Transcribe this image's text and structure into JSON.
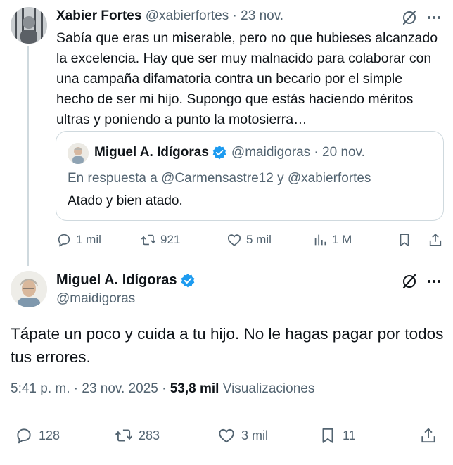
{
  "parent_tweet": {
    "author_name": "Xabier Fortes",
    "handle_date": "@xabierfortes · 23 nov.",
    "text": "Sabía que eras un miserable, pero no que hubieses alcanzado la excelencia. Hay que ser muy malnacido para colaborar con una campaña difamatoria contra un becario por el simple hecho de ser mi hijo. Supongo que estás haciendo méritos ultras y poniendo a punto la motosierra…",
    "quote": {
      "author_name": "Miguel A. Idígoras",
      "handle_date": "@maidigoras · 20 nov.",
      "reply_to": "En respuesta a @Carmensastre12 y @xabierfortes",
      "text": "Atado y bien atado."
    },
    "actions": {
      "replies": "1 mil",
      "reposts": "921",
      "likes": "5 mil",
      "views": "1 M"
    }
  },
  "main_tweet": {
    "author_name": "Miguel A. Idígoras",
    "handle": "@maidigoras",
    "text": "Tápate un poco y cuida a tu hijo. No le hagas pagar por todos tus errores.",
    "timestamp": "5:41 p. m. · 23 nov. 2025 ·",
    "views_count": "53,8 mil",
    "views_label": "Visualizaciones",
    "actions": {
      "replies": "128",
      "reposts": "283",
      "likes": "3 mil",
      "bookmarks": "11"
    }
  },
  "colors": {
    "text": "#0f1419",
    "muted": "#536471",
    "verified": "#1d9bf0",
    "border": "#cfd9de"
  },
  "icons": [
    "grok-icon",
    "more-icon",
    "verified-icon",
    "reply-icon",
    "repost-icon",
    "like-icon",
    "views-icon",
    "bookmark-icon",
    "share-icon"
  ]
}
